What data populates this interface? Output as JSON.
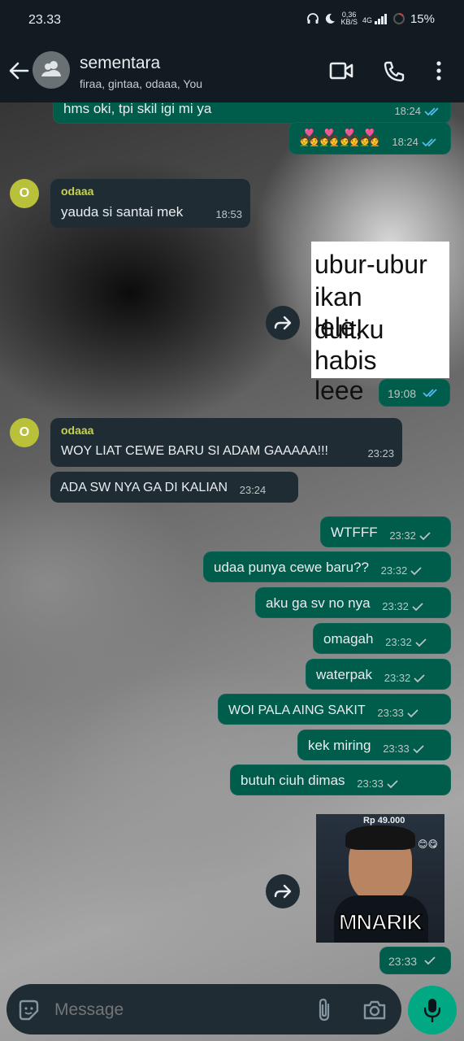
{
  "status_bar": {
    "time": "23.33",
    "speed_value": "0,36",
    "speed_unit": "KB/S",
    "network": "4G",
    "battery": "15%"
  },
  "header": {
    "title": "sementara",
    "subtitle": "firaa, gintaa, odaaa, You"
  },
  "messages": {
    "m0": {
      "text": "hms oki, tpi skil igi mi ya",
      "time": "18:24"
    },
    "m1": {
      "text": "💑💑💑💑",
      "time": "18:24"
    },
    "m2": {
      "sender": "odaaa",
      "text": "yauda si santai mek",
      "time": "18:53"
    },
    "sticker1": {
      "lines": [
        "ubur-ubur",
        "ikan lele,",
        "duitku",
        "habis leee"
      ],
      "time": "19:08"
    },
    "m3": {
      "sender": "odaaa",
      "text": "WOY LIAT CEWE BARU SI ADAM GAAAAA!!!",
      "time": "23:23"
    },
    "m4": {
      "text": "ADA SW NYA GA DI KALIAN",
      "time": "23:24"
    },
    "m5": {
      "text": "WTFFF",
      "time": "23:32"
    },
    "m6": {
      "text": "udaa punya cewe baru??",
      "time": "23:32"
    },
    "m7": {
      "text": "aku ga sv no nya",
      "time": "23:32"
    },
    "m8": {
      "text": "omagah",
      "time": "23:32"
    },
    "m9": {
      "text": "waterpak",
      "time": "23:32"
    },
    "m10": {
      "text": "WOI PALA AING SAKIT",
      "time": "23:33"
    },
    "m11": {
      "text": "kek miring",
      "time": "23:33"
    },
    "m12": {
      "text": "butuh ciuh dimas",
      "time": "23:33"
    },
    "sticker2": {
      "price": "Rp 49.000",
      "caption": "MNARIK",
      "time": "23:33"
    }
  },
  "avatar_letter": "O",
  "composer": {
    "placeholder": "Message"
  },
  "colors": {
    "out_bubble": "#005c4b",
    "in_bubble": "#1f2c34",
    "accent": "#00a884",
    "read_tick": "#53bdeb",
    "sender": "#c7d34a"
  }
}
